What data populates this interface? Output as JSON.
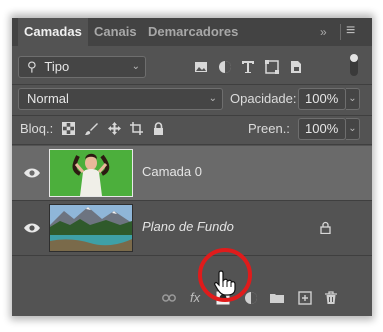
{
  "tabs": [
    {
      "label": "Camadas",
      "active": true
    },
    {
      "label": "Canais",
      "active": false
    },
    {
      "label": "Demarcadores",
      "active": false
    }
  ],
  "panel_controls": {
    "collapse_glyph": "»",
    "menu_glyph": "≡"
  },
  "filter": {
    "label": "Tipo",
    "icons": [
      "image-filter-icon",
      "adjustment-filter-icon",
      "type-filter-icon",
      "shape-filter-icon",
      "smart-object-filter-icon"
    ]
  },
  "blend": {
    "mode": "Normal",
    "opacity_label": "Opacidade:",
    "opacity_value": "100%"
  },
  "locks": {
    "label": "Bloq.:",
    "icons": [
      "lock-transparent-icon",
      "lock-image-icon",
      "lock-position-icon",
      "lock-artboard-icon",
      "lock-all-icon"
    ],
    "fill_label": "Preen.:",
    "fill_value": "100%"
  },
  "layers": [
    {
      "name": "Camada 0",
      "visible": true,
      "selected": true,
      "locked": false
    },
    {
      "name": "Plano de Fundo",
      "visible": true,
      "selected": false,
      "locked": true,
      "italic": true
    }
  ],
  "footer_icons": [
    "link-layers-icon",
    "fx-icon",
    "add-mask-icon",
    "adjustment-layer-icon",
    "group-folder-icon",
    "new-layer-icon",
    "trash-icon"
  ],
  "footer": {
    "fx_label": "fx"
  },
  "colors": {
    "panel": "#535353",
    "tabbar": "#434343",
    "selected_layer": "#6a6a6a",
    "highlight_circle": "#e01b1b",
    "green_screen": "#4caf3c"
  }
}
